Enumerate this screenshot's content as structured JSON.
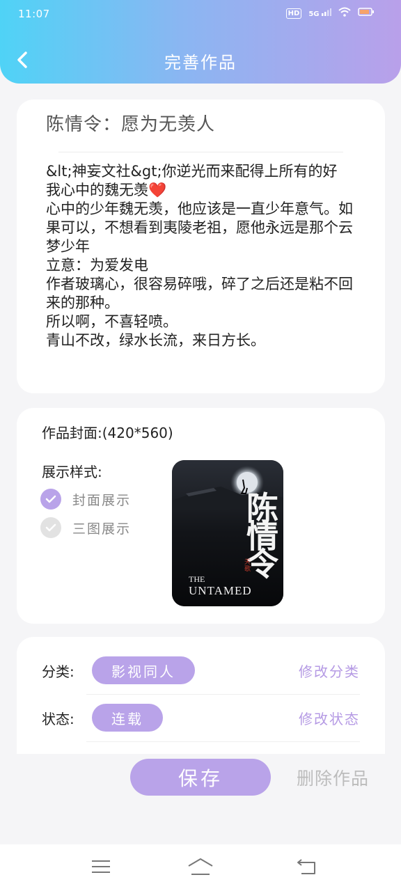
{
  "status_bar": {
    "time": "11:07",
    "hd": "HD",
    "network": "5G",
    "icons": [
      "hd-icon",
      "signal-icon",
      "wifi-icon",
      "battery-icon"
    ]
  },
  "header": {
    "title": "完善作品",
    "back_icon": "chevron-left-icon",
    "colors": {
      "start": "#4fd3f6",
      "end": "#b9a0ea"
    }
  },
  "work": {
    "title": "陈情令：愿为无羡人",
    "description": "&lt;神妄文社&gt;你逆光而来配得上所有的好\n我心中的魏无羡❤️\n心中的少年魏无羡，他应该是一直少年意气。如果可以，不想看到夷陵老祖，愿他永远是那个云梦少年\n立意：为爱发电\n作者玻璃心，很容易碎哦，碎了之后还是粘不回来的那种。\n所以啊，不喜轻喷。\n青山不改，绿水长流，来日方长。"
  },
  "cover": {
    "label": "作品封面:(420*560)",
    "style_label": "展示样式:",
    "options": [
      {
        "label": "封面展示",
        "selected": true
      },
      {
        "label": "三图展示",
        "selected": false
      }
    ],
    "image": {
      "calligraphy": "陈情令",
      "seal": "天歌",
      "en_line1": "THE",
      "en_line2": "UNTAMED"
    }
  },
  "meta": {
    "category_label": "分类:",
    "category_value": "影视同人",
    "category_action": "修改分类",
    "status_label": "状态:",
    "status_value": "连载",
    "status_action": "修改状态"
  },
  "actions": {
    "save": "保存",
    "delete": "删除作品"
  },
  "accent_color": "#b9a3e9",
  "nav": [
    "menu-icon",
    "home-icon",
    "back-icon"
  ]
}
